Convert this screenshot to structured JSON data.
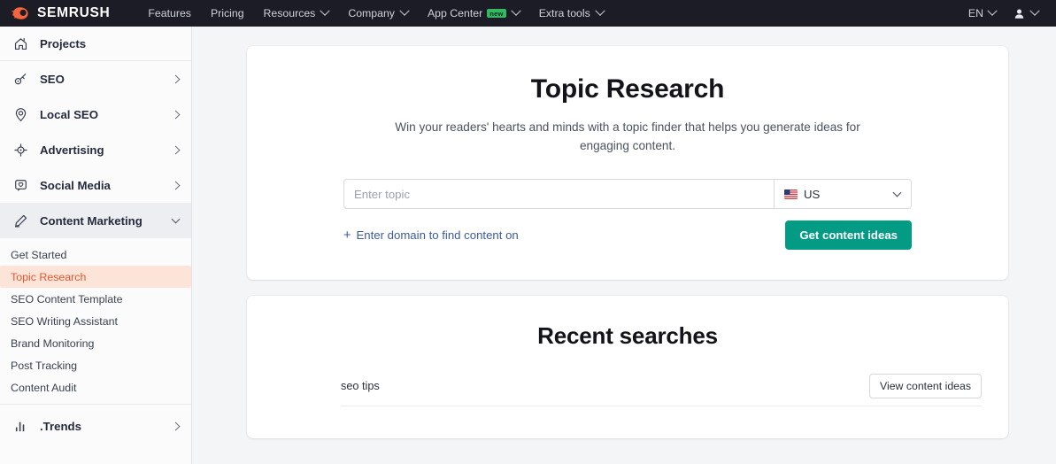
{
  "topnav": {
    "brand": "SEMRUSH",
    "brand_icon": "semrush-comet-logo",
    "items": [
      {
        "label": "Features",
        "has_caret": false,
        "badge": ""
      },
      {
        "label": "Pricing",
        "has_caret": false,
        "badge": ""
      },
      {
        "label": "Resources",
        "has_caret": true,
        "badge": ""
      },
      {
        "label": "Company",
        "has_caret": true,
        "badge": ""
      },
      {
        "label": "App Center",
        "has_caret": true,
        "badge": "new"
      },
      {
        "label": "Extra tools",
        "has_caret": true,
        "badge": ""
      }
    ],
    "language": "EN",
    "user_icon": "user-avatar-icon",
    "badge_color": "#34b864",
    "background": "#1c1c26"
  },
  "sidebar": {
    "items": [
      {
        "label": "Projects",
        "icon": "home-icon",
        "chevron": "none"
      },
      {
        "label": "SEO",
        "icon": "magnifier-key-icon",
        "chevron": "right"
      },
      {
        "label": "Local SEO",
        "icon": "map-pin-icon",
        "chevron": "right"
      },
      {
        "label": "Advertising",
        "icon": "target-crosshair-icon",
        "chevron": "right"
      },
      {
        "label": "Social Media",
        "icon": "speech-bubble-heart-icon",
        "chevron": "right"
      },
      {
        "label": "Content Marketing",
        "icon": "pencil-icon",
        "chevron": "down"
      }
    ],
    "subitems": [
      {
        "label": "Get Started",
        "active": false
      },
      {
        "label": "Topic Research",
        "active": true
      },
      {
        "label": "SEO Content Template",
        "active": false
      },
      {
        "label": "SEO Writing Assistant",
        "active": false
      },
      {
        "label": "Brand Monitoring",
        "active": false
      },
      {
        "label": "Post Tracking",
        "active": false
      },
      {
        "label": "Content Audit",
        "active": false
      }
    ],
    "footer": {
      "label": ".Trends",
      "icon": "bar-chart-icon",
      "chevron": "right"
    },
    "active_item_bg": "#eceef1",
    "active_sub_bg": "#fde4d8",
    "active_sub_color": "#e4572c"
  },
  "hero": {
    "title": "Topic Research",
    "subtitle": "Win your readers' hearts and minds with a topic finder that helps you generate ideas for engaging content.",
    "topic_placeholder": "Enter topic",
    "topic_value": "",
    "country": "US",
    "country_flag": "us-flag-icon",
    "domain_link": "Enter domain to find content on",
    "domain_link_prefix": "+",
    "cta_label": "Get content ideas",
    "cta_color": "#049b84"
  },
  "recent": {
    "title": "Recent searches",
    "rows": [
      {
        "term": "seo tips",
        "action": "View content ideas"
      }
    ]
  }
}
